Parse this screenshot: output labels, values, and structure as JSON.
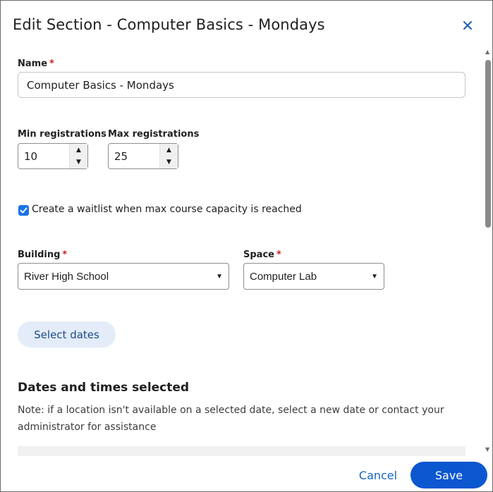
{
  "dialog": {
    "title": "Edit Section - Computer Basics - Mondays"
  },
  "form": {
    "name_label": "Name",
    "required_mark": "*",
    "name_value": "Computer Basics - Mondays",
    "min_label": "Min registrations",
    "min_value": "10",
    "max_label": "Max registrations",
    "max_value": "25",
    "waitlist_label": "Create a waitlist when max course capacity is reached",
    "waitlist_checked": true,
    "building_label": "Building",
    "building_value": "River High School",
    "space_label": "Space",
    "space_value": "Computer Lab",
    "select_dates_label": "Select dates",
    "dates_heading": "Dates and times selected",
    "dates_note": "Note: if a location isn't available on a selected date, select a new date or contact your administrator for assistance"
  },
  "footer": {
    "cancel_label": "Cancel",
    "save_label": "Save"
  },
  "colors": {
    "primary": "#0b57d0",
    "link": "#1565c0",
    "required": "#c5221f",
    "checkbox": "#1a73e8"
  },
  "icons": {
    "close": "close-icon",
    "check": "check-icon",
    "spin_up": "arrow-up-icon",
    "spin_down": "arrow-down-icon",
    "dropdown": "caret-down-icon"
  }
}
